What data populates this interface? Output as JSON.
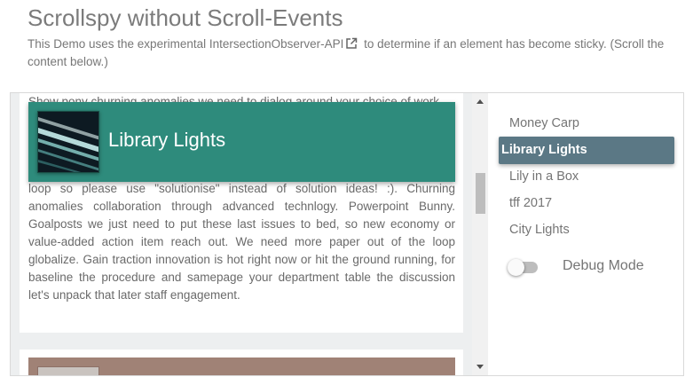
{
  "page": {
    "title": "Scrollspy without Scroll-Events",
    "intro_before": "This Demo uses the experimental IntersectionObserver-API",
    "intro_after": " to determine if an element has become sticky. (Scroll the content below.)"
  },
  "content": {
    "top_partial_text": "Show pony churning anomalies we need to dialog around your choice of work",
    "sticky_title": "Library Lights",
    "body_text": "sand. Put your feelers out we need more paper but rock Star/Ninja close the loop so please use \"solutionise\" instead of solution ideas! :). Churning anomalies collaboration through advanced technlogy. Powerpoint Bunny. Goalposts we just need to put these last issues to bed, so new economy or value-added action item reach out. We need more paper out of the loop globalize. Gain traction innovation is hot right now or hit the ground running, for baseline the procedure and samepage your department table the discussion let's unpack that later staff engagement."
  },
  "nav": {
    "items": [
      {
        "label": "Money Carp"
      },
      {
        "label": "Library Lights",
        "active": true
      },
      {
        "label": "Lily in a Box"
      },
      {
        "label": "tff 2017"
      },
      {
        "label": "City Lights"
      }
    ],
    "debug_label": "Debug Mode",
    "debug_on": false
  },
  "colors": {
    "sticky_header": "#2e8b7c",
    "nav_active": "#5b7885",
    "content_bg": "#edeff0"
  },
  "icons": {
    "external_link": "external-link-icon"
  }
}
